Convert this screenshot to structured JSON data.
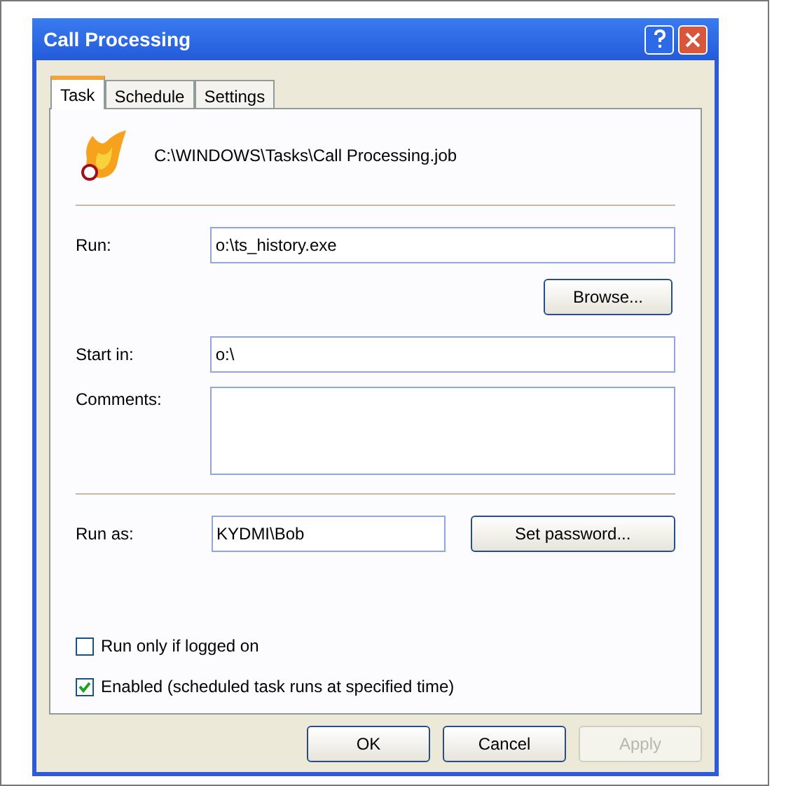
{
  "window": {
    "title": "Call Processing"
  },
  "tabs": [
    {
      "label": "Task",
      "selected": true
    },
    {
      "label": "Schedule",
      "selected": false
    },
    {
      "label": "Settings",
      "selected": false
    }
  ],
  "task_path": "C:\\WINDOWS\\Tasks\\Call Processing.job",
  "run": {
    "label": "Run:",
    "value": "o:\\ts_history.exe"
  },
  "browse_button": "Browse...",
  "start_in": {
    "label": "Start in:",
    "value": "o:\\"
  },
  "comments": {
    "label": "Comments:"
  },
  "run_as": {
    "label": "Run as:",
    "value": "KYDMI\\Bob"
  },
  "set_password_button": "Set password...",
  "checkboxes": [
    {
      "label": "Run only if logged on",
      "checked": false
    },
    {
      "label": "Enabled (scheduled task runs at specified time)",
      "checked": true
    }
  ],
  "buttons": [
    {
      "label": "OK",
      "disabled": false
    },
    {
      "label": "Cancel",
      "disabled": false
    },
    {
      "label": "Apply",
      "disabled": true
    }
  ]
}
